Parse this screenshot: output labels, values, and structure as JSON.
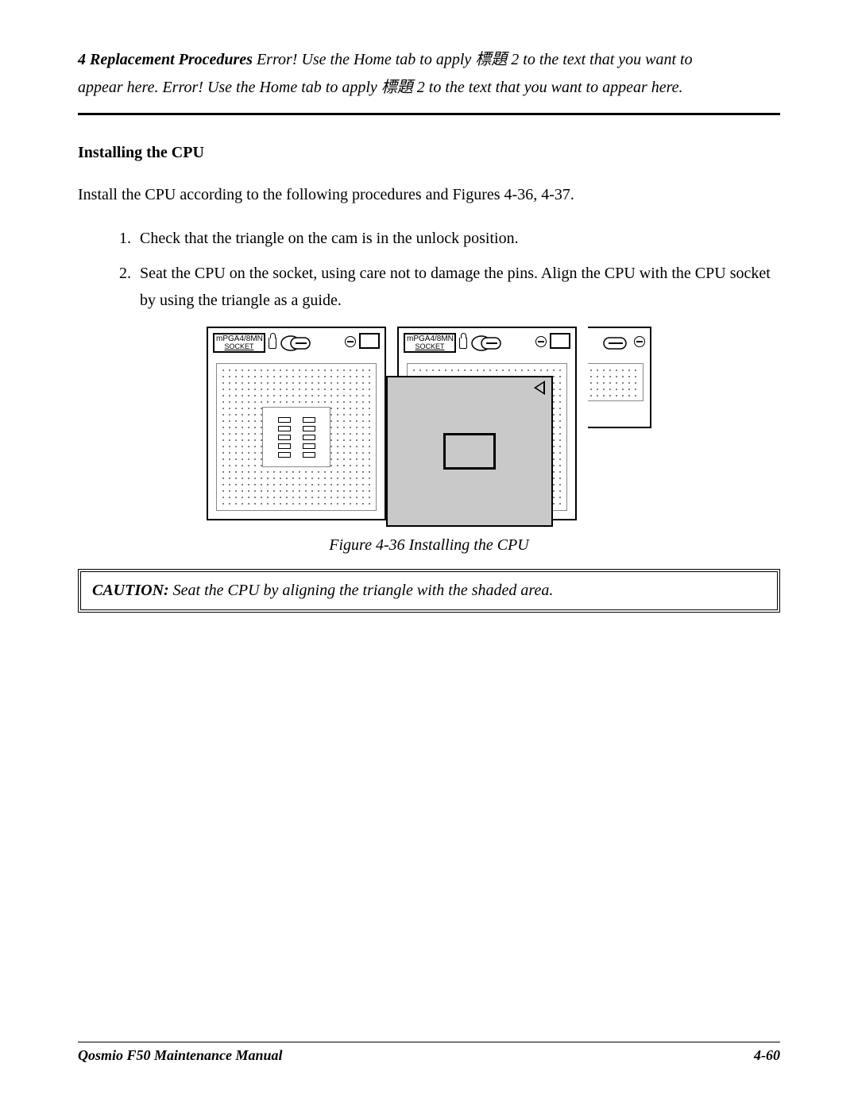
{
  "header": {
    "lead": "4 Replacement Procedures",
    "rest1": "  Error! Use the Home tab to apply 標題 2 to the text that you want to",
    "rest2": "appear here. Error! Use the Home tab to apply 標題 2 to the text that you want to appear here."
  },
  "section_heading": "Installing the CPU",
  "intro": "Install the CPU according to the following procedures and Figures 4-36, 4-37.",
  "steps": [
    "Check that the triangle on the cam is in the unlock position.",
    "Seat the CPU on the socket, using care not to damage the pins. Align the CPU with the CPU socket by using the triangle as a guide."
  ],
  "socket_label_line1": "mPGA4/8MN",
  "socket_label_line2": "SOCKET",
  "figure_caption": "Figure 4-36 Installing the CPU",
  "caution_label": "CAUTION:",
  "caution_text": " Seat the CPU by aligning the triangle with the shaded area.",
  "footer_left": "Qosmio F50  Maintenance Manual",
  "footer_right": "4-60"
}
